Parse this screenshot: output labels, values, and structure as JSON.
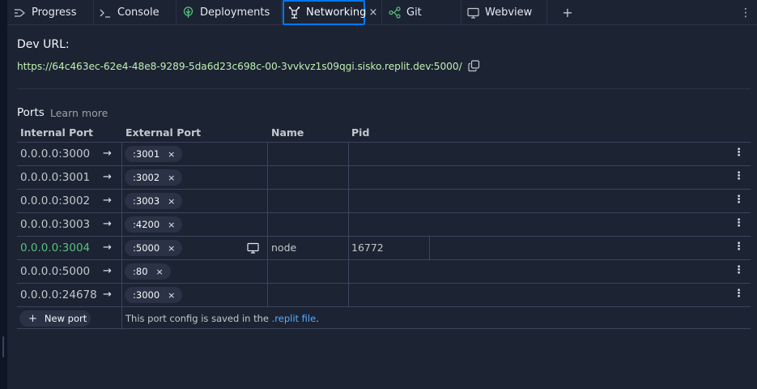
{
  "tabs": [
    {
      "label": "Progress",
      "icon": "progress-icon"
    },
    {
      "label": "Console",
      "icon": "console-icon"
    },
    {
      "label": "Deployments",
      "icon": "deployments-icon"
    },
    {
      "label": "Networking",
      "icon": "networking-icon",
      "active": true
    },
    {
      "label": "Git",
      "icon": "git-icon"
    },
    {
      "label": "Webview",
      "icon": "webview-icon"
    }
  ],
  "tab_close": "×",
  "tab_add": "+",
  "tab_more": "⋮",
  "dev": {
    "label": "Dev URL:",
    "url": "https://64c463ec-62e4-48e8-9289-5da6d23c698c-00-3vvkvz1s09qgi.sisko.replit.dev:5000/"
  },
  "ports": {
    "title": "Ports",
    "learn_more": "Learn more",
    "headers": {
      "internal": "Internal Port",
      "external": "External Port",
      "name": "Name",
      "pid": "Pid"
    },
    "rows": [
      {
        "internal": "0.0.0.0:3000",
        "external": ":3001",
        "name": "",
        "pid": "",
        "active": false
      },
      {
        "internal": "0.0.0.0:3001",
        "external": ":3002",
        "name": "",
        "pid": "",
        "active": false
      },
      {
        "internal": "0.0.0.0:3002",
        "external": ":3003",
        "name": "",
        "pid": "",
        "active": false
      },
      {
        "internal": "0.0.0.0:3003",
        "external": ":4200",
        "name": "",
        "pid": "",
        "active": false
      },
      {
        "internal": "0.0.0.0:3004",
        "external": ":5000",
        "name": "node",
        "pid": "16772",
        "active": true
      },
      {
        "internal": "0.0.0.0:5000",
        "external": ":80",
        "name": "",
        "pid": "",
        "active": false
      },
      {
        "internal": "0.0.0.0:24678",
        "external": ":3000",
        "name": "",
        "pid": "",
        "active": false
      }
    ],
    "arrow": "→",
    "chip_close": "×",
    "row_menu": "⋮",
    "new_port_label": "New port",
    "new_port_plus": "+",
    "config_note_prefix": "This port config is saved in the",
    "config_note_link": ".replit file",
    "config_note_suffix": "."
  },
  "colors": {
    "background": "#1c2333",
    "accent": "#0079f2",
    "url_green": "#bff0b0",
    "active_port_green": "#58c27d",
    "link_blue": "#57abff"
  }
}
